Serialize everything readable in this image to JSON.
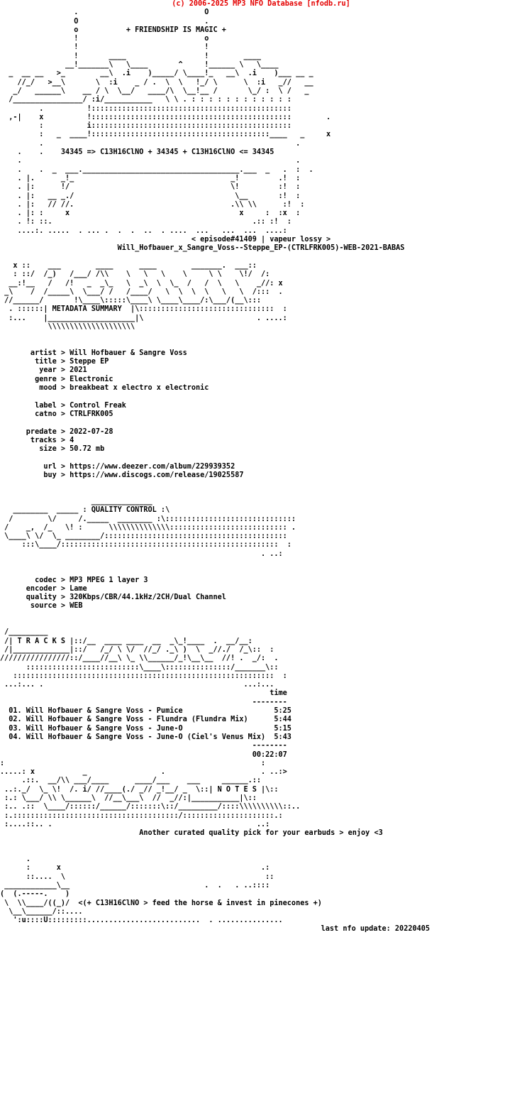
{
  "header": {
    "copyright": "(c) 2006-2025 MP3 NFO Database [nfodb.ru]",
    "copyright_color": "#e40000",
    "tagline": "+ FRIENDSHIP IS MAGIC +",
    "formula_line": "34345 => C13H16ClNO + 34345 + C13H16ClNO <= 34345",
    "episode_line": "< episode#41409 | vapeur lossy >",
    "release_name": "Will_Hofbauer_x_Sangre_Voss--Steppe_EP-(CTRLFRK005)-WEB-2021-BABAS"
  },
  "banners": {
    "metadata_summary": "METADATA SUMMARY",
    "quality_control": "QUALITY CONTROL",
    "tracks": "T R A C K S",
    "notes": "N O T E S"
  },
  "metadata": {
    "rows": [
      {
        "key": "artist",
        "sep": ">",
        "value": "Will Hofbauer & Sangre Voss"
      },
      {
        "key": "title",
        "sep": ">",
        "value": "Steppe EP"
      },
      {
        "key": "year",
        "sep": ">",
        "value": "2021"
      },
      {
        "key": "genre",
        "sep": ">",
        "value": "Electronic"
      },
      {
        "key": "mood",
        "sep": ">",
        "value": "breakbeat x electro x electronic"
      },
      {
        "key": "label",
        "sep": ">",
        "value": "Control Freak"
      },
      {
        "key": "catno",
        "sep": ">",
        "value": "CTRLFRK005"
      },
      {
        "key": "predate",
        "sep": ">",
        "value": "2022-07-28"
      },
      {
        "key": "tracks",
        "sep": ">",
        "value": "4"
      },
      {
        "key": "size",
        "sep": ">",
        "value": "50.72 mb"
      },
      {
        "key": "url",
        "sep": ">",
        "value": "https://www.deezer.com/album/229939352"
      },
      {
        "key": "buy",
        "sep": ">",
        "value": "https://www.discogs.com/release/19025587"
      }
    ],
    "block_text": "       artist > Will Hofbauer & Sangre Voss\n        title > Steppe EP\n         year > 2021\n        genre > Electronic\n         mood > breakbeat x electro x electronic\n\n        label > Control Freak\n        catno > CTRLFRK005\n\n      predate > 2022-07-28\n       tracks > 4\n         size > 50.72 mb\n\n          url > https://www.deezer.com/album/229939352\n          buy > https://www.discogs.com/release/19025587"
  },
  "quality": {
    "rows": [
      {
        "key": "codec",
        "sep": ">",
        "value": "MP3 MPEG 1 layer 3"
      },
      {
        "key": "encoder",
        "sep": ">",
        "value": "Lame"
      },
      {
        "key": "quality",
        "sep": ">",
        "value": "320Kbps/CBR/44.1kHz/2CH/Dual Channel"
      },
      {
        "key": "source",
        "sep": ">",
        "value": "WEB"
      }
    ],
    "block_text": "        codec > MP3 MPEG 1 layer 3\n      encoder > Lame\n      quality > 320Kbps/CBR/44.1kHz/2CH/Dual Channel\n       source > WEB"
  },
  "tracklist": {
    "time_header": "time",
    "rule": "--------",
    "tracks": [
      {
        "num": "01.",
        "title": "Will Hofbauer & Sangre Voss - Pumice",
        "time": "5:25"
      },
      {
        "num": "02.",
        "title": "Will Hofbauer & Sangre Voss - Flundra (Flundra Mix)",
        "time": "5:44"
      },
      {
        "num": "03.",
        "title": "Will Hofbauer & Sangre Voss - June-O",
        "time": "5:15"
      },
      {
        "num": "04.",
        "title": "Will Hofbauer & Sangre Voss - June-O (Ciel's Venus Mix)",
        "time": "5:43"
      }
    ],
    "total_time": "00:22:07",
    "block_text": "                                                              time\n                                                          --------\n  01. Will Hofbauer & Sangre Voss - Pumice                     5:25\n  02. Will Hofbauer & Sangre Voss - Flundra (Flundra Mix)      5:44\n  03. Will Hofbauer & Sangre Voss - June-O                     5:15\n  04. Will Hofbauer & Sangre Voss - June-O (Ciel's Venus Mix)  5:43\n                                                          --------\n                                                          00:22:07"
  },
  "notes": {
    "message": "Another curated quality pick for your earbuds > enjoy <3",
    "greeting": "<(+ C13H16ClNO > feed the horse & invest in pinecones +)",
    "last_update": "last nfo update: 20220405"
  },
  "art": {
    "top_banner": "                 .                             O\n                 O                             .\n                 o           + FRIENDSHIP IS MAGIC +\n                 !                             o\n                 !                             !\n                 !       ____                  !        ____\n               __!_______\\   \\____       ^     !______ \\   \\____\n  _  __ __   >_        __\\  .i    )_____/ \\____!_   __\\  .i    )___ __ _\n    //_/   >__\\       \\  :i    _ / .  \\  \\   !_/ \\      \\  :i   _//   __\n   _/   ______\\    __ / \\  \\__/   ____/\\  \\__!__ /       \\_/ :  \\ /   _\n  /________________/ :i/___________   \\ \\ . : : : : : : : : : : : :\n         .          !::::::::::::::::::::::::::::::::::::::::::::::\n  ,-|    x          !::::::::::::::::::::::::::::::::::::::::::::::        .\n         :          i::::::::::::::::::::::::::::::::::::::::::::::\n         :   _  ____!:::::::::::::::::::::::::::::::::::::::::____   _     x",
    "mid_frame": "         .                                                          .\n    .    .    34345 => C13H16ClNO + 34345 + C13H16ClNO <= 34345\n    .                                                               .\n    .    .  _  ___.____________________________________.___  _   .  :  .\n    . |.      _!_                                    _!         .!  :\n    . |:      !/                                     \\!         :!  :\n    . |:   __ _./                                     \\__       :!  :\n    . |:   // //.                                    .\\\\ \\\\      :!  :\n    . |: :     x                                       x     :  :x  :\n    . !: ::.                                              .:: :!  :\n    ....:. .....  . ... .  .  .  ..  . ....  ...   ...  ...  ....:",
    "metadata_banner": "   x ::    ___        ____      ____        _______.  ___::\n   : ::/  /_)   /___/ /\\\\    \\   \\   \\    \\     \\ \\    \\!/  /:\n  __:!__   /   /!   _  _\\_   \\  _\\  \\  \\_  /   /  \\   \\    _//: x\n _\\    /  /_____\\  \\___/ /   /____/   \\  \\  \\  \\   \\   \\  /:::  .\n //______/       !\\____\\:::::\\____\\ \\____\\____/:\\___/(__\\:::\n  . ::::::| METADATA SUMMARY  |\\:::::::::::::::::::::::::::::::  :\n  :...    |____________________|\\                          . ....:\n           \\\\\\\\\\\\\\\\\\\\\\\\\\\\\\\\\\\\\\\\",
    "quality_banner": "                     ______________\n   ________  _____ : QUALITY CONTROL :\\\n  /        \\/     /._____  ________ :\\::::::::::::::::::::::::::::::\n /    _,  /_   \\! :      \\\\\\\\\\\\\\\\\\\\\\\\\\\\::::::::::::::::::::::::::: .\n \\____\\ \\/  \\_ ________/::::::::::::::::::::::::::::::::::::::::::\n     :::\\____/::::::::::::::::::::::::::::::::::::::::::::::::::  :\n                                                            . ..:",
    "tracks_banner": " /_________\n /| T R A C K S |::/__  ____ ____  __  _\\_!____  .  __/__:\n /|_____________|::/   /_/ \\ \\/  //_/ ._\\ )  \\  _//./  /_\\::  :\n////////////////::/____//__\\ \\_ \\\\______/_!\\__\\__  //! .  _/:  .\n      ::::::::::::::::::::::::::\\____\\:::::::::::::::/_______\\::\n   ::::::::::::::::::::::::::::::::::::::::::::::::::::::::::::  :\n ...:... .                                              ...:...",
    "notes_banner": ":                                                           :\n.....: x           _                 .                      . ..:>\n     .::.  __/\\\\ ___/____      ____/___    ___     ______.::\n ..:._/  \\_ \\!  /. i/ //____(./ _// _!__/ _  \\::| N O T E S |\\::\n :.: \\___/ \\\\ \\______\\  //__\\___\\  //  _//:|___________|\\::\n :.. .::  \\____/::::::/______/:::::::\\::/_________/::::\\\\\\\\\\\\\\\\\\\\::..\n :.::::::::::::::::::::::::::::::::::::::/:::::::::::::::::::::.:\n :....::.. .                                               ..:",
    "footer_horse": "      .\n      :      x                                              .:\n      ::....  \\                                              ::\n ____________\\__                               .  .   . ..::::\n(  (.-----.    )\n \\  \\\\____/((_)/  <(+ C13H16ClNO > feed the horse & invest in pinecones +)\n  \\__\\______/::....\n   ':u::::U:::::::::..........................  . ..............."
  }
}
